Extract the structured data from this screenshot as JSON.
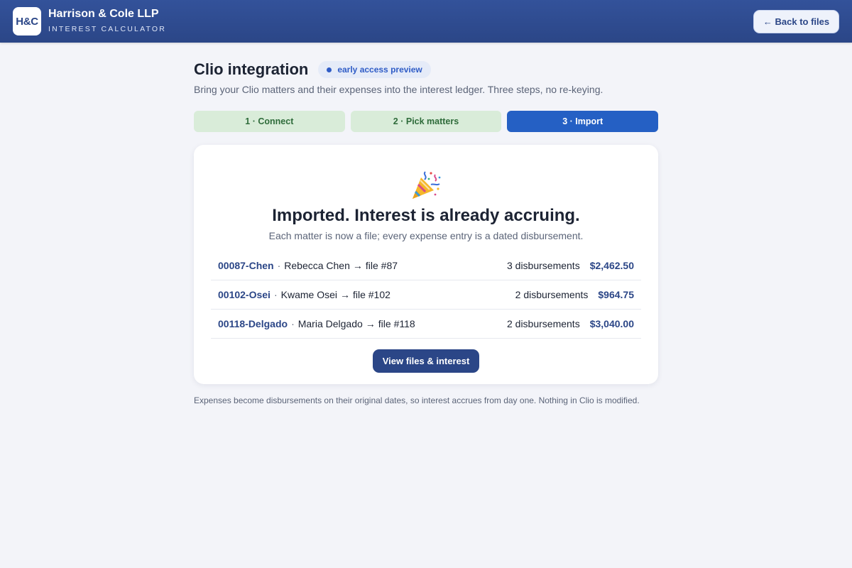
{
  "header": {
    "logo_text": "H&C",
    "firm_name": "Harrison & Cole LLP",
    "app_subtitle": "INTEREST CALCULATOR",
    "back_button_label": "← Back to files"
  },
  "page": {
    "title": "Clio integration",
    "badge": "early access preview",
    "subtitle": "Bring your Clio matters and their expenses into the interest ledger. Three steps, no re-keying."
  },
  "steps": [
    {
      "label": "1 · Connect",
      "state": "done"
    },
    {
      "label": "2 · Pick matters",
      "state": "done"
    },
    {
      "label": "3 · Import",
      "state": "active"
    }
  ],
  "result": {
    "icon": "party-popper-icon",
    "title": "Imported. Interest is already accruing.",
    "subtitle": "Each matter is now a file; every expense entry is a dated disbursement.",
    "matters": [
      {
        "id": "00087-Chen",
        "client": "Rebecca Chen",
        "file": "file #87",
        "count": "3 disbursements",
        "amount": "$2,462.50"
      },
      {
        "id": "00102-Osei",
        "client": "Kwame Osei",
        "file": "file #102",
        "count": "2 disbursements",
        "amount": "$964.75"
      },
      {
        "id": "00118-Delgado",
        "client": "Maria Delgado",
        "file": "file #118",
        "count": "2 disbursements",
        "amount": "$3,040.00"
      }
    ],
    "button_label": "View files & interest"
  },
  "footnote": "Expenses become disbursements on their original dates, so interest accrues from day one. Nothing in Clio is modified.",
  "colors": {
    "header_bg": "#2b4687",
    "accent": "#2560c4",
    "step_done_bg": "#d9ecd9",
    "step_done_text": "#2e6b3a",
    "page_bg": "#f3f4f9"
  }
}
